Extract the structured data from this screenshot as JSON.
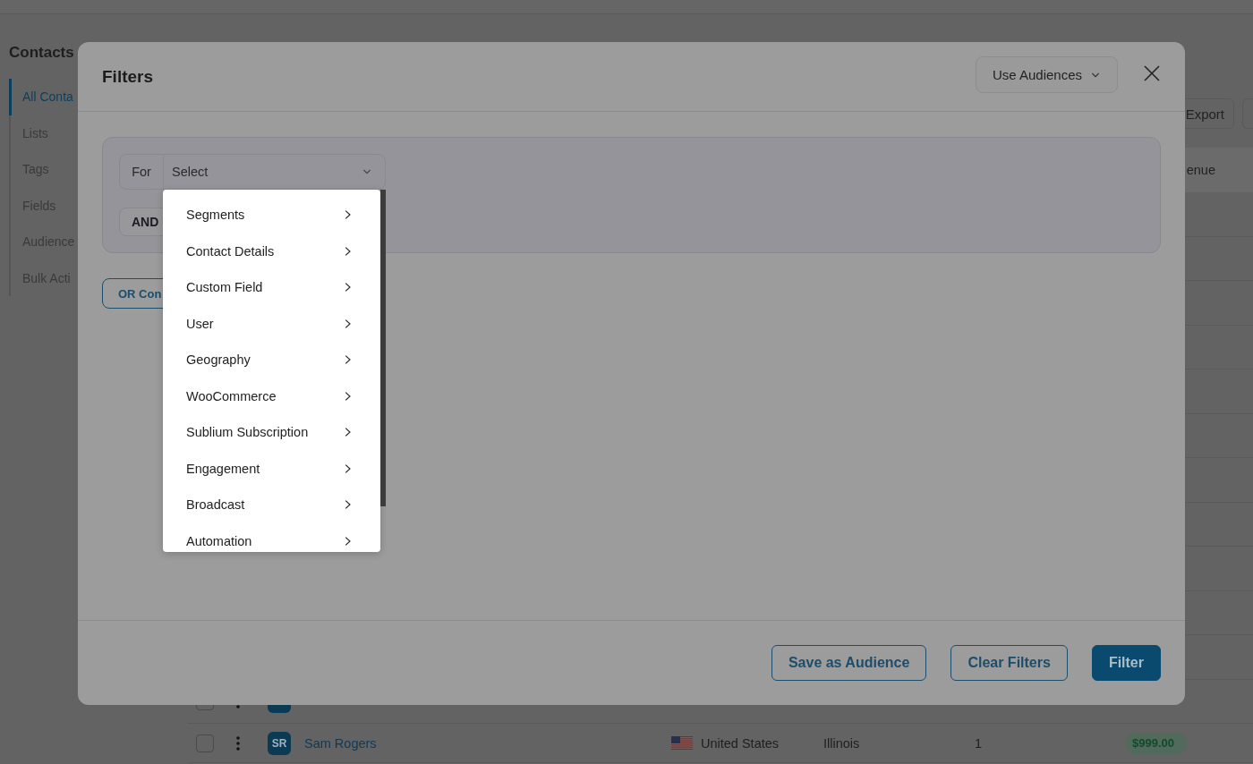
{
  "sidebar": {
    "title": "Contacts",
    "items": [
      {
        "label": "All Conta",
        "selected": true
      },
      {
        "label": "Lists",
        "selected": false
      },
      {
        "label": "Tags",
        "selected": false
      },
      {
        "label": "Fields",
        "selected": false
      },
      {
        "label": "Audience",
        "selected": false
      },
      {
        "label": "Bulk Acti",
        "selected": false
      }
    ]
  },
  "toolbar": {
    "buttons": [
      "Export"
    ]
  },
  "table": {
    "columns": [
      "enue"
    ],
    "rows": [
      {
        "kind": "covered"
      },
      {
        "kind": "covered"
      },
      {
        "kind": "covered"
      },
      {
        "kind": "covered"
      },
      {
        "kind": "covered"
      },
      {
        "kind": "covered"
      },
      {
        "kind": "covered"
      },
      {
        "kind": "covered"
      },
      {
        "kind": "covered"
      },
      {
        "kind": "covered"
      },
      {
        "kind": "covered"
      },
      {
        "kind": "partial",
        "checked": false
      },
      {
        "kind": "full",
        "checked": false,
        "initials": "SR",
        "name": "Sam Rogers",
        "country": "United States",
        "state": "Illinois",
        "count": "1",
        "revenue": "$999.00"
      }
    ]
  },
  "modal": {
    "title": "Filters",
    "audience_button": "Use Audiences",
    "filter_group": {
      "for_label": "For",
      "select": {
        "placeholder": "Select"
      },
      "and_button": "AND"
    },
    "or_button": "OR Con",
    "menu": {
      "items": [
        {
          "label": "Segments"
        },
        {
          "label": "Contact Details"
        },
        {
          "label": "Custom Field"
        },
        {
          "label": "User"
        },
        {
          "label": "Geography"
        },
        {
          "label": "WooCommerce"
        },
        {
          "label": "Sublium Subscription"
        },
        {
          "label": "Engagement"
        },
        {
          "label": "Broadcast"
        },
        {
          "label": "Automation"
        }
      ]
    },
    "footer_buttons": [
      {
        "label": "Save as Audience",
        "kind": "outline"
      },
      {
        "label": "Clear Filters",
        "kind": "outline"
      },
      {
        "label": "Filter",
        "kind": "primary"
      }
    ]
  }
}
